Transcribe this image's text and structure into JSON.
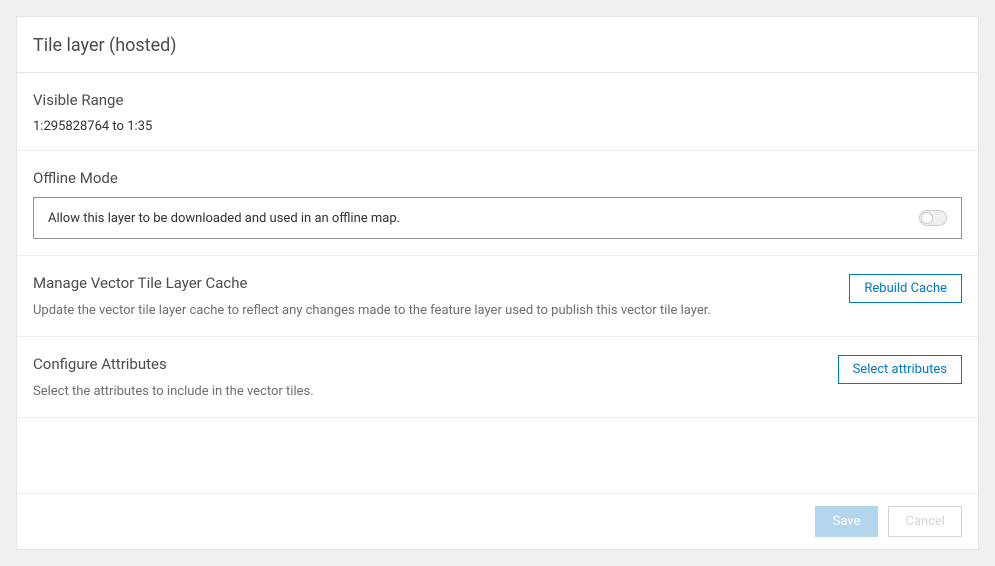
{
  "header": {
    "title": "Tile layer (hosted)"
  },
  "visibleRange": {
    "label": "Visible Range",
    "value": "1:295828764 to 1:35"
  },
  "offlineMode": {
    "label": "Offline Mode",
    "toggleText": "Allow this layer to be downloaded and used in an offline map.",
    "enabled": false
  },
  "manageCache": {
    "label": "Manage Vector Tile Layer Cache",
    "description": "Update the vector tile layer cache to reflect any changes made to the feature layer used to publish this vector tile layer.",
    "buttonLabel": "Rebuild Cache"
  },
  "configureAttributes": {
    "label": "Configure Attributes",
    "description": "Select the attributes to include in the vector tiles.",
    "buttonLabel": "Select attributes"
  },
  "footer": {
    "saveLabel": "Save",
    "cancelLabel": "Cancel"
  }
}
